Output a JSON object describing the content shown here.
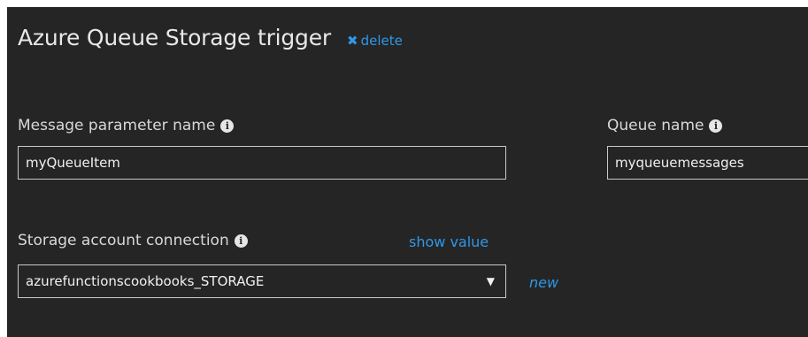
{
  "header": {
    "title": "Azure Queue Storage trigger",
    "delete_label": "delete"
  },
  "fields": {
    "message_param": {
      "label": "Message parameter name",
      "value": "myQueueItem"
    },
    "queue_name": {
      "label": "Queue name",
      "value": "myqueuemessages"
    },
    "storage_connection": {
      "label": "Storage account connection",
      "show_value_label": "show value",
      "selected": "azurefunctionscookbooks_STORAGE",
      "new_label": "new"
    }
  },
  "icons": {
    "info": "info-icon",
    "close": "close-icon",
    "dropdown": "caret-down-icon"
  },
  "colors": {
    "background": "#252525",
    "accent": "#2f97e8",
    "text": "#e8e8e8"
  }
}
